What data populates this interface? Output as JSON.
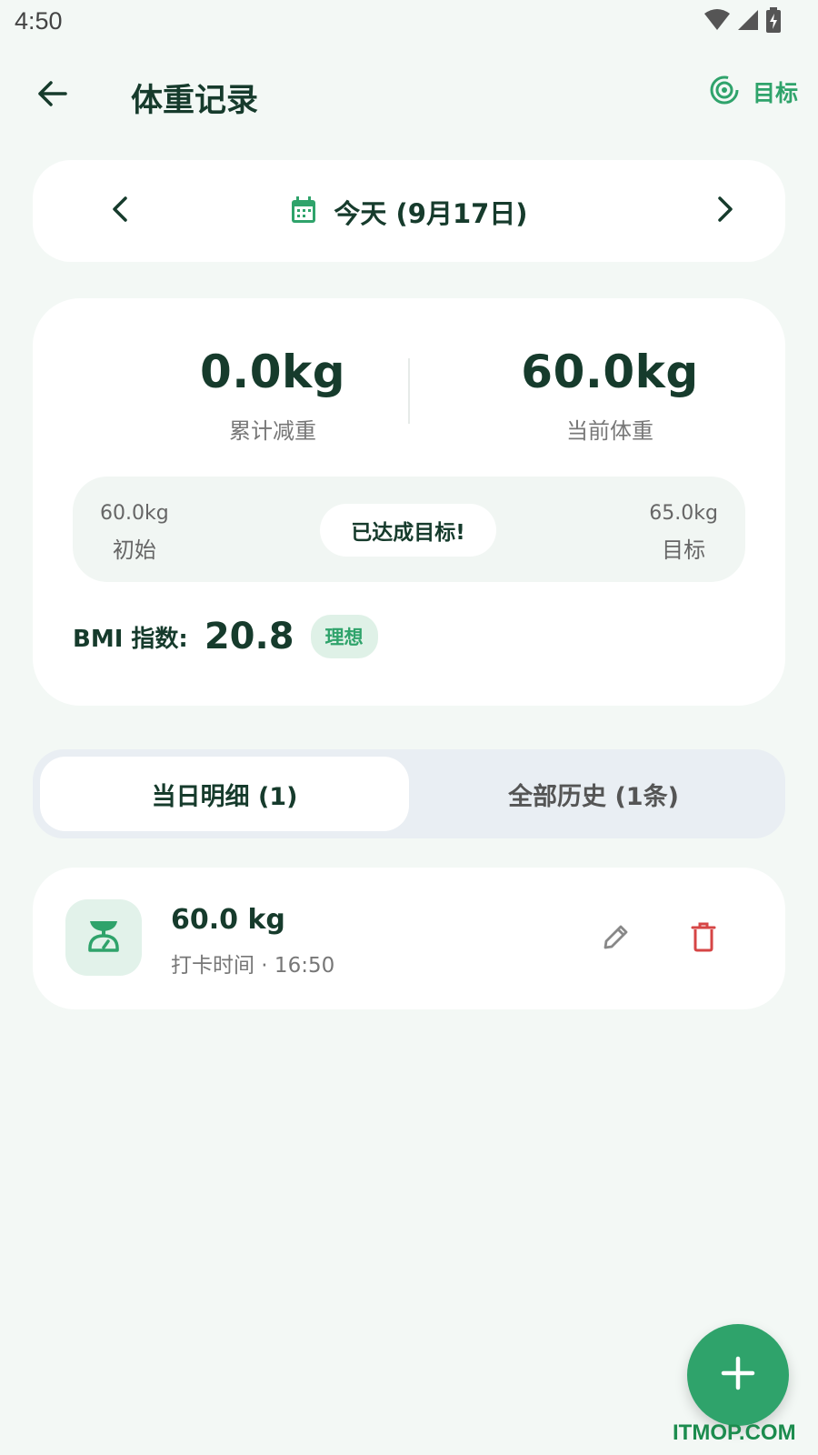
{
  "status_bar": {
    "time": "4:50"
  },
  "header": {
    "title": "体重记录",
    "goal_label": "目标"
  },
  "date_nav": {
    "label": "今天 (9月17日)"
  },
  "summary": {
    "lost_value": "0.0kg",
    "lost_label": "累计减重",
    "current_value": "60.0kg",
    "current_label": "当前体重",
    "start_value": "60.0kg",
    "start_label": "初始",
    "goal_value": "65.0kg",
    "goal_label": "目标",
    "status_badge": "已达成目标!",
    "bmi_label": "BMI 指数:",
    "bmi_value": "20.8",
    "bmi_tag": "理想"
  },
  "tabs": [
    {
      "label": "当日明细 (1)",
      "active": true
    },
    {
      "label": "全部历史 (1条)",
      "active": false
    }
  ],
  "records": [
    {
      "weight": "60.0 kg",
      "time": "打卡时间 · 16:50"
    }
  ],
  "watermark": "ITMOP.COM",
  "colors": {
    "accent": "#2fa36b",
    "text_dark": "#163b2c",
    "delete_red": "#d64545",
    "background": "#f3f8f5"
  }
}
